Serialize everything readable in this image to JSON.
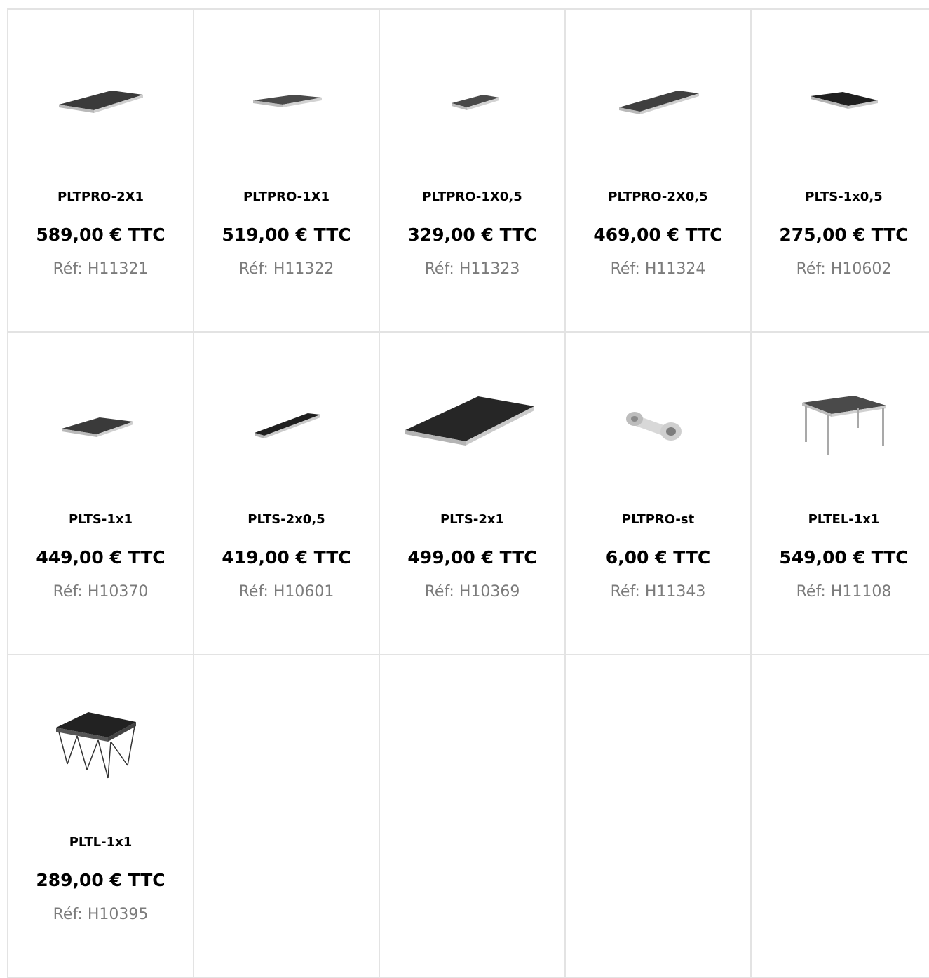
{
  "products": [
    {
      "name": "PLTPRO-2X1",
      "price": "589,00 € TTC",
      "ref": "Réf: H11321",
      "image": "stage-platform-icon"
    },
    {
      "name": "PLTPRO-1X1",
      "price": "519,00 € TTC",
      "ref": "Réf: H11322",
      "image": "stage-platform-icon"
    },
    {
      "name": "PLTPRO-1X0,5",
      "price": "329,00 € TTC",
      "ref": "Réf: H11323",
      "image": "stage-platform-icon"
    },
    {
      "name": "PLTPRO-2X0,5",
      "price": "469,00 € TTC",
      "ref": "Réf: H11324",
      "image": "stage-platform-icon"
    },
    {
      "name": "PLTS-1x0,5",
      "price": "275,00 € TTC",
      "ref": "Réf: H10602",
      "image": "stage-platform-icon"
    },
    {
      "name": "PLTS-1x1",
      "price": "449,00 € TTC",
      "ref": "Réf: H10370",
      "image": "stage-platform-icon"
    },
    {
      "name": "PLTS-2x0,5",
      "price": "419,00 € TTC",
      "ref": "Réf: H10601",
      "image": "stage-platform-icon"
    },
    {
      "name": "PLTS-2x1",
      "price": "499,00 € TTC",
      "ref": "Réf: H10369",
      "image": "stage-platform-icon"
    },
    {
      "name": "PLTPRO-st",
      "price": "6,00 € TTC",
      "ref": "Réf: H11343",
      "image": "connector-clamp-icon"
    },
    {
      "name": "PLTEL-1x1",
      "price": "549,00 € TTC",
      "ref": "Réf: H11108",
      "image": "legged-platform-icon"
    },
    {
      "name": "PLTL-1x1",
      "price": "289,00 € TTC",
      "ref": "Réf: H10395",
      "image": "folding-riser-icon"
    }
  ],
  "colors": {
    "grid_line": "#e3e3e3",
    "ref_text": "#7b7b7b",
    "text": "#000000"
  }
}
